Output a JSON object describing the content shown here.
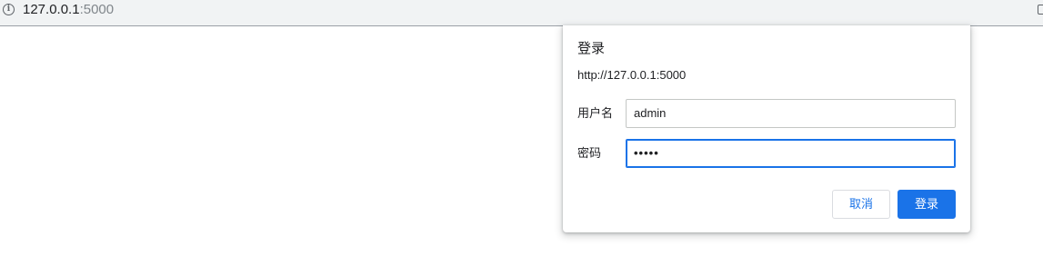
{
  "browser": {
    "url_host": "127.0.0.1",
    "url_port": ":5000",
    "info_icon": "i"
  },
  "dialog": {
    "title": "登录",
    "origin": "http://127.0.0.1:5000",
    "username_label": "用户名",
    "username_value": "admin",
    "password_label": "密码",
    "password_value": "•••••",
    "cancel_label": "取消",
    "login_label": "登录"
  },
  "colors": {
    "accent": "#1a73e8",
    "toolbar_bg": "#f1f3f4"
  }
}
